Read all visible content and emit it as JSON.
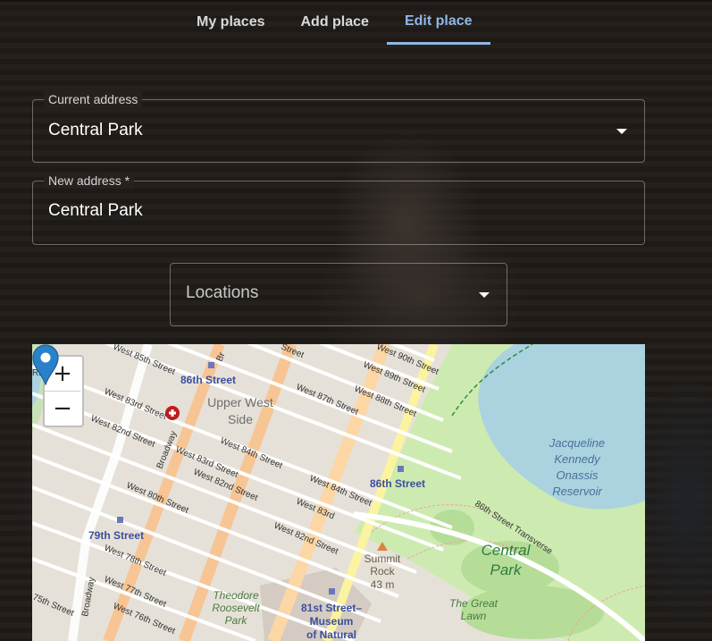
{
  "tabs": [
    {
      "label": "My places",
      "active": false
    },
    {
      "label": "Add place",
      "active": false
    },
    {
      "label": "Edit place",
      "active": true
    }
  ],
  "current_address": {
    "label": "Current address",
    "value": "Central Park"
  },
  "new_address": {
    "label": "New address *",
    "value": "Central Park"
  },
  "locations": {
    "placeholder": "Locations"
  },
  "map": {
    "zoom_in": "+",
    "zoom_out": "−",
    "labels": {
      "upper_west_side_1": "Upper West",
      "upper_west_side_2": "Side",
      "reservoir_1": "Jacqueline",
      "reservoir_2": "Kennedy",
      "reservoir_3": "Onassis",
      "reservoir_4": "Reservoir",
      "central_park_1": "Central",
      "central_park_2": "Park",
      "great_lawn_1": "The Great",
      "great_lawn_2": "Lawn",
      "summit_rock_1": "Summit",
      "summit_rock_2": "Rock",
      "summit_rock_3": "43 m",
      "roosevelt_1": "Theodore",
      "roosevelt_2": "Roosevelt",
      "roosevelt_3": "Park",
      "station_86_west": "86th Street",
      "station_86_east": "86th Street",
      "station_79": "79th Street",
      "station_81_1": "81st Street–",
      "station_81_2": "Museum",
      "station_81_3": "of Natural",
      "st_w85": "West 85th Street",
      "st_w83": "West 83rd Street",
      "st_w82": "West 82nd Street",
      "st_w80": "West 80th Street",
      "st_w78": "West 78th Street",
      "st_w77": "West 77th Street",
      "st_w76": "West 76th Street",
      "st_w75": "75th Street",
      "st_e84": "West 84th Street",
      "st_e83": "West 83rd Street",
      "st_e82": "West 82nd Street",
      "st_n84": "West 84th Street",
      "st_n83": "West 83rd",
      "st_n82": "West 82nd Street",
      "st_w87": "West 87th Street",
      "st_w88": "West 88th Street",
      "st_w90": "West 90th Street",
      "st_w89": "West 89th Street",
      "st_street": "Street",
      "st_br": "Br",
      "broadway_1": "Broadway",
      "broadway_2": "Broadway",
      "transverse": "86th Street Transverse",
      "riv": "Riv"
    }
  }
}
